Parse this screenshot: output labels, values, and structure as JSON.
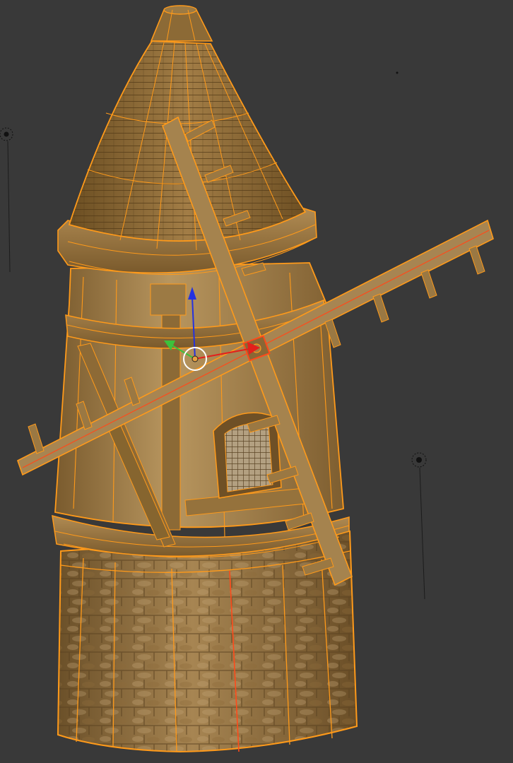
{
  "viewport": {
    "mode": "edit-mode-wireframe-overlay",
    "background_color": "#393939",
    "selection_color": "#ff9a1a",
    "active_edge_color": "#ff4a1a"
  },
  "objects": {
    "model": "windmill",
    "parts": [
      "roof-cone",
      "roof-cap",
      "upper-ring",
      "wooden-body",
      "middle-band",
      "window",
      "lower-ring",
      "stone-base",
      "sails",
      "hub"
    ]
  },
  "gizmo": {
    "icons": [
      "z-axis-arrow-icon",
      "y-axis-arrow-icon",
      "x-axis-arrow-icon",
      "pivot-circle-icon"
    ],
    "colors": {
      "x": "#e3201b",
      "y": "#3cc23c",
      "z": "#2432e0",
      "pivot": "#ffffff"
    }
  },
  "lamps": [
    "lamp-icon",
    "lamp-icon",
    "lamp-icon"
  ]
}
